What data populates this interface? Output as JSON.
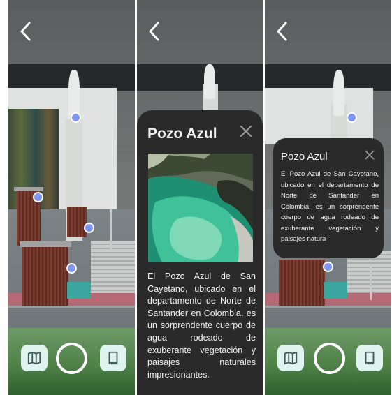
{
  "panels": [
    {
      "id": "screen-map-view"
    },
    {
      "id": "screen-detail-expanded"
    },
    {
      "id": "screen-detail-compact"
    }
  ],
  "info_card": {
    "title": "Pozo Azul",
    "description_full": "El Pozo Azul de San Cayetano, ubicado en el departamento de Norte de Santander en Colombia, es un sorprendente cuerpo de agua rodeado de exuberante vegetación y paisajes naturales impresionantes.",
    "description_preview": "El Pozo Azul de San Cayetano, ubicado en el departamento de Norte de Santander en Colombia, es un sorprendente cuerpo de agua rodeado de exuberante vegetación y paisajes natura-",
    "close_icon": "close-icon",
    "photo_subject": "pozo-azul-photo"
  },
  "toolbar": {
    "map_icon": "map-icon",
    "book_icon": "book-icon",
    "capture_icon": "shutter-ring"
  },
  "navigation": {
    "back_icon": "chevron-left-icon"
  },
  "colors": {
    "card_bg": "#2a2a2a",
    "marker": "#7f95f2",
    "toolbar_button_bg": "#dff3ef",
    "toolbar_icon": "#3e5a58"
  }
}
